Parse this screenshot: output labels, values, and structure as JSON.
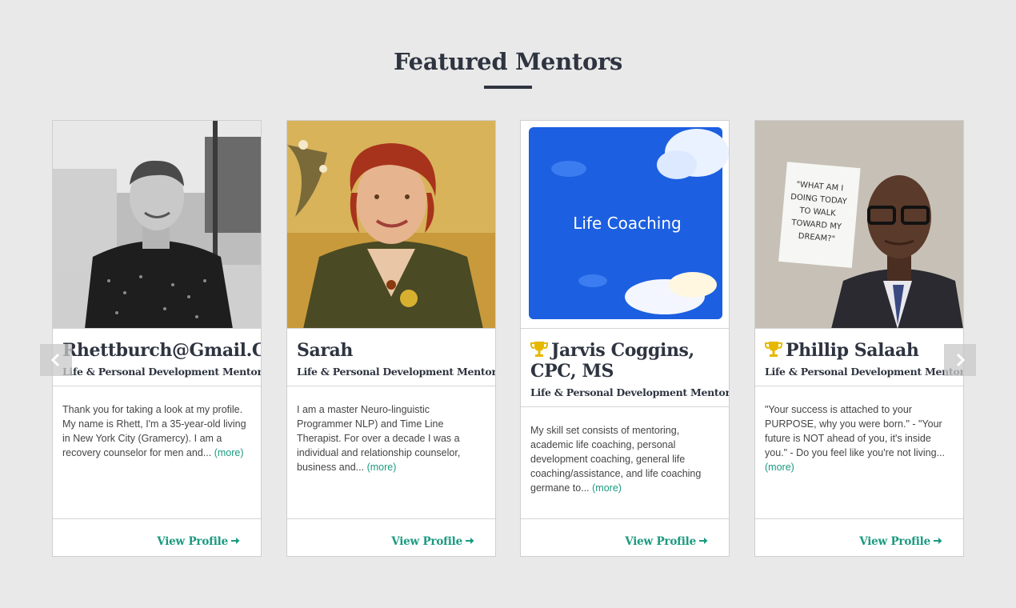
{
  "section": {
    "title": "Featured Mentors"
  },
  "colors": {
    "accent": "#1a9a80",
    "heading": "#2e3440",
    "background": "#e9e9e9",
    "trophy": "#e6b800"
  },
  "mentors": [
    {
      "name": "Rhettburch@Gmail.Com",
      "featured": false,
      "role": "Life & Personal Development Mentor",
      "bio": "Thank you for taking a look at my profile. My name is Rhett, I'm a 35-year-old living in New York City (Gramercy). I am a recovery counselor for men and...",
      "more": "(more)",
      "view_profile": "View Profile"
    },
    {
      "name": "Sarah",
      "featured": false,
      "role": "Life & Personal Development Mentor",
      "bio": "I am a master Neuro-linguistic Programmer NLP) and Time Line Therapist. For over a decade I was a individual and relationship counselor, business and...",
      "more": "(more)",
      "view_profile": "View Profile"
    },
    {
      "name": "Jarvis Coggins, CPC, MS",
      "featured": true,
      "role": "Life & Personal Development Mentor",
      "photo_text": "Life Coaching",
      "bio": "My skill set consists of mentoring, academic life coaching, personal development coaching, general life coaching/assistance, and life coaching germane to...",
      "more": "(more)",
      "view_profile": "View Profile"
    },
    {
      "name": "Phillip Salaah",
      "featured": true,
      "role": "Life & Personal Development Mentor",
      "photo_sign": [
        "\"WHAT AM I",
        "DOING TODAY",
        "TO WALK",
        "TOWARD MY",
        "DREAM?\""
      ],
      "bio": "\"Your success is attached to your PURPOSE, why you were born.\" - \"Your future is NOT ahead of you, it's inside you.\" - Do you feel like you're not living...",
      "more": "(more)",
      "view_profile": "View Profile"
    }
  ],
  "nav": {
    "prev_icon": "chevron-left-icon",
    "next_icon": "chevron-right-icon"
  }
}
